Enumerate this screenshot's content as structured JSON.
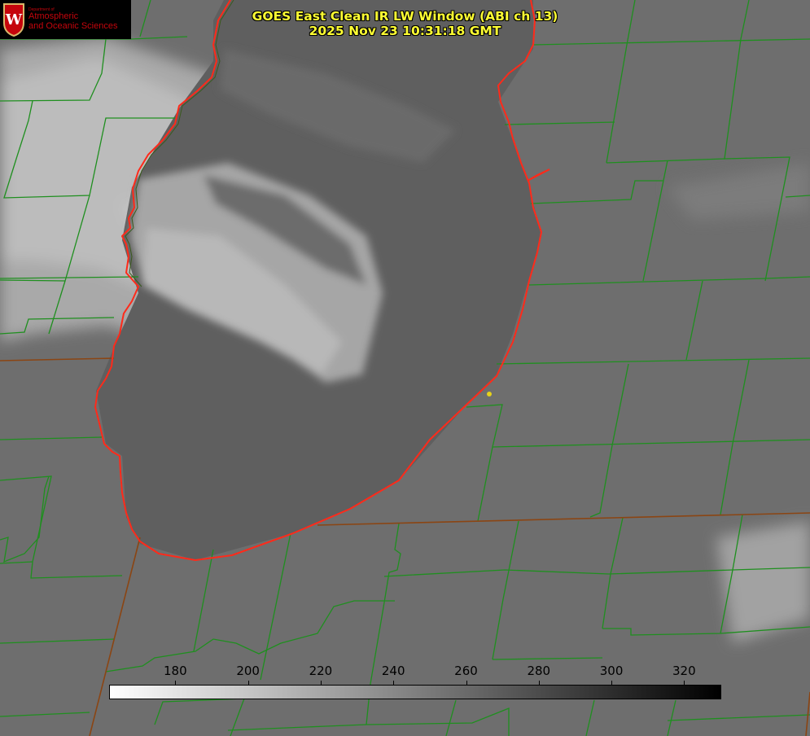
{
  "logo": {
    "department": "Department of",
    "line1": "Atmospheric",
    "line2": "and Oceanic Sciences",
    "seal_letter": "W"
  },
  "title": {
    "line1": "GOES East Clean IR LW Window (ABI ch 13)",
    "line2": "2025 Nov 23 10:31:18 GMT"
  },
  "colorbar": {
    "min": 162,
    "max": 330,
    "gradient_from": "#ffffff",
    "gradient_to": "#000000",
    "ticks": [
      "180",
      "200",
      "220",
      "240",
      "260",
      "280",
      "300",
      "320"
    ]
  },
  "colors": {
    "background": "#6e6e6e",
    "lake_fill": "#5f5f5f",
    "cloud_light": "#bdbdbd",
    "county_lines": "#1f8f1f",
    "state_line": "#8b4513",
    "shoreline": "#ff2a1a",
    "marker": "#e6d21a",
    "title_text": "#ffff33"
  }
}
